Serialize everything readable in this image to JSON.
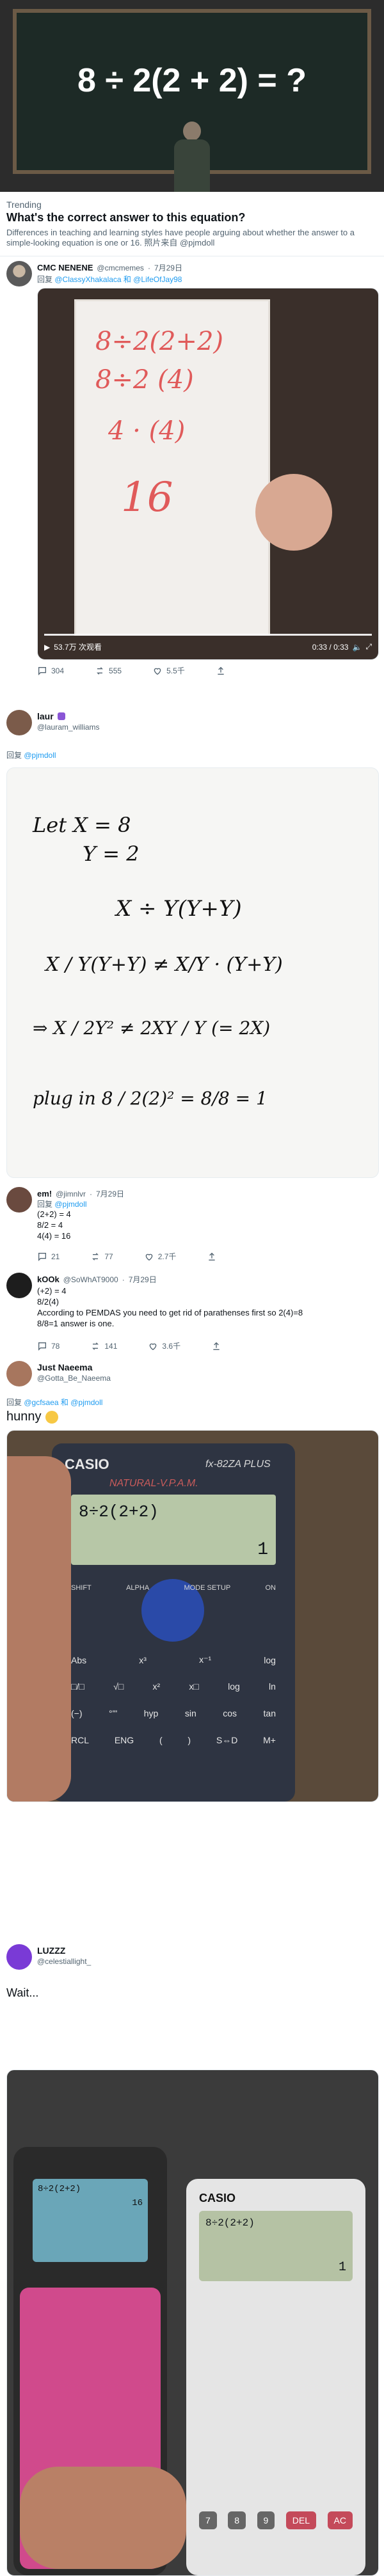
{
  "header": {
    "puzzle": "8 ÷ 2(2 + 2) = ?",
    "trending_label": "Trending",
    "title": "What's the correct answer to this equation?",
    "summary": "Differences in teaching and learning styles have people arguing about whether the answer to a simple-looking equation is one or 16. 照片来自 @pjmdoll"
  },
  "tweet1": {
    "name": "CMC NENENE",
    "handle": "@cmcmemes",
    "date": "7月29日",
    "reply_prefix": "回复",
    "reply_to": "@ClassyXhakalaca 和 @LifeOfJay98",
    "video": {
      "lines": [
        "8÷2(2+2)",
        "8÷2 (4)",
        "4 · (4)",
        "16"
      ],
      "views": "53.7万 次观看",
      "time": "0:33 / 0:33"
    },
    "actions": {
      "replies": "304",
      "retweets": "555",
      "likes": "5.5千"
    }
  },
  "tweet2": {
    "name": "laur",
    "handle": "@lauram_williams",
    "reply_prefix": "回复",
    "reply_to": "@pjmdoll",
    "whiteboard": [
      "Let  X = 8",
      "Y = 2",
      "X ÷ Y(Y+Y)",
      "X / Y(Y+Y)  ≠  X/Y · (Y+Y)",
      "⇒  X / 2Y²  ≠  2XY / Y  (= 2X)",
      "plug in  8 / 2(2)²  =  8/8 = 1"
    ]
  },
  "reply1": {
    "name": "em!",
    "handle": "@jimnlvr",
    "date": "7月29日",
    "reply_prefix": "回复",
    "reply_to": "@pjmdoll",
    "lines": [
      "(2+2) = 4",
      "8/2 = 4",
      "4(4) = 16"
    ],
    "actions": {
      "replies": "21",
      "retweets": "77",
      "likes": "2.7千"
    }
  },
  "reply2": {
    "name": "kOOk",
    "handle": "@SoWhAT9000",
    "date": "7月29日",
    "lines": [
      "(+2) = 4",
      "8/2(4)",
      "According to PEMDAS you need to get rid of parathenses first so 2(4)=8",
      "8/8=1 answer is one."
    ],
    "actions": {
      "replies": "78",
      "retweets": "141",
      "likes": "3.6千"
    }
  },
  "tweet3": {
    "name": "Just Naeema",
    "handle": "@Gotta_Be_Naeema",
    "reply_prefix": "回复",
    "reply_to": "@gcfsaea 和 @pjmdoll",
    "text": "hunny",
    "calculator": {
      "brand": "CASIO",
      "model": "fx-82ZA PLUS",
      "subtitle": "NATURAL-V.P.A.M.",
      "display": "8÷2(2+2)",
      "result": "1",
      "keys_row1": [
        "SHIFT",
        "ALPHA",
        "MODE SETUP",
        "ON"
      ],
      "keys_row2": [
        "Abs",
        "x³",
        "x⁻¹",
        "log"
      ],
      "keys_row3": [
        "□/□",
        "√□",
        "x²",
        "x□",
        "log",
        "ln"
      ],
      "keys_row4": [
        "(−)",
        "°'\"",
        "hyp",
        "sin",
        "cos",
        "tan"
      ],
      "keys_row5": [
        "RCL",
        "ENG",
        "(",
        ")",
        "S⇔D",
        "M+"
      ]
    }
  },
  "tweet4": {
    "name": "LUZZZ",
    "handle": "@celestiallight_",
    "text": "Wait...",
    "calc_left": {
      "display": "8÷2(2+2)",
      "result": "16"
    },
    "calc_right": {
      "brand": "CASIO",
      "display": "8÷2(2+2)",
      "result": "1",
      "keys": [
        "7",
        "8",
        "9",
        "DEL",
        "AC"
      ]
    }
  }
}
